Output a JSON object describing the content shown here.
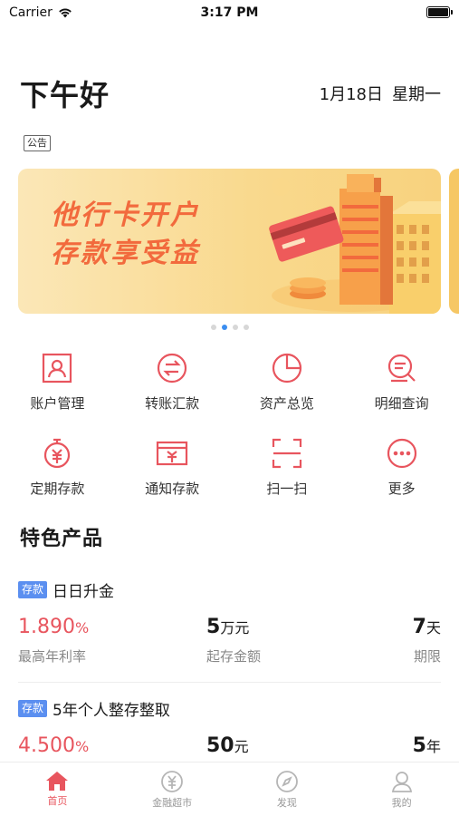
{
  "status_bar": {
    "carrier": "Carrier",
    "time": "3:17 PM"
  },
  "header": {
    "greeting": "下午好",
    "date": "1月18日",
    "weekday": "星期一",
    "notice_tag": "公告"
  },
  "banner": {
    "line1": "他行卡开户",
    "line2": "存款享受益",
    "active_dot": 1,
    "dot_count": 4
  },
  "quick_actions": [
    {
      "label": "账户管理",
      "icon": "account-icon"
    },
    {
      "label": "转账汇款",
      "icon": "transfer-icon"
    },
    {
      "label": "资产总览",
      "icon": "pie-chart-icon"
    },
    {
      "label": "明细查询",
      "icon": "detail-search-icon"
    },
    {
      "label": "定期存款",
      "icon": "fixed-deposit-icon"
    },
    {
      "label": "通知存款",
      "icon": "notice-deposit-icon"
    },
    {
      "label": "扫一扫",
      "icon": "scan-icon"
    },
    {
      "label": "更多",
      "icon": "more-icon"
    }
  ],
  "featured": {
    "title": "特色产品",
    "products": [
      {
        "tag": "存款",
        "name": "日日升金",
        "rate": "1.890",
        "rate_unit": "%",
        "amount": "5",
        "amount_unit": "万元",
        "term": "7",
        "term_unit": "天",
        "rate_label": "最高年利率",
        "amount_label": "起存金额",
        "term_label": "期限"
      },
      {
        "tag": "存款",
        "name": "5年个人整存整取",
        "rate": "4.500",
        "rate_unit": "%",
        "amount": "50",
        "amount_unit": "元",
        "term": "5",
        "term_unit": "年"
      }
    ]
  },
  "tab_bar": {
    "tabs": [
      {
        "label": "首页",
        "icon": "home-icon",
        "active": true
      },
      {
        "label": "金融超市",
        "icon": "yuan-icon",
        "active": false
      },
      {
        "label": "发现",
        "icon": "compass-icon",
        "active": false
      },
      {
        "label": "我的",
        "icon": "profile-icon",
        "active": false
      }
    ]
  },
  "colors": {
    "accent_red": "#e8555e",
    "tag_blue": "#5b8ff0",
    "dot_active": "#3b8ef0",
    "banner_text": "#f26a3d"
  }
}
